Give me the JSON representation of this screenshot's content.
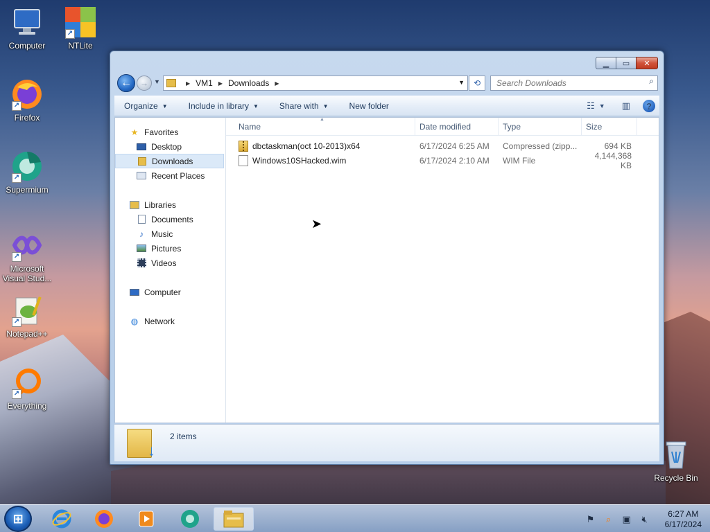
{
  "desktop": {
    "icons": [
      {
        "label": "Computer",
        "glyph": "monitor-icon"
      },
      {
        "label": "NTLite",
        "glyph": "ntlite-icon"
      },
      {
        "label": "Firefox",
        "glyph": "firefox-icon"
      },
      {
        "label": "Supermium",
        "glyph": "supermium-icon"
      },
      {
        "label": "Microsoft Visual Stud...",
        "glyph": "visual-studio-icon"
      },
      {
        "label": "Notepad++",
        "glyph": "notepadpp-icon"
      },
      {
        "label": "Everything",
        "glyph": "everything-icon"
      },
      {
        "label": "Recycle Bin",
        "glyph": "recycle-bin-icon"
      }
    ]
  },
  "explorer": {
    "breadcrumb": [
      "VM1",
      "Downloads"
    ],
    "search_placeholder": "Search Downloads",
    "toolbar": {
      "organize": "Organize",
      "include_in_library": "Include in library",
      "share_with": "Share with",
      "new_folder": "New folder"
    },
    "nav": {
      "favorites": "Favorites",
      "desktop": "Desktop",
      "downloads": "Downloads",
      "recent_places": "Recent Places",
      "libraries": "Libraries",
      "documents": "Documents",
      "music": "Music",
      "pictures": "Pictures",
      "videos": "Videos",
      "computer": "Computer",
      "network": "Network"
    },
    "columns": {
      "name": "Name",
      "date_modified": "Date modified",
      "type": "Type",
      "size": "Size"
    },
    "files": [
      {
        "name": "dbctaskman(oct 10-2013)x64",
        "date": "6/17/2024 6:25 AM",
        "type": "Compressed (zipp...",
        "size": "694 KB"
      },
      {
        "name": "Windows10SHacked.wim",
        "date": "6/17/2024 2:10 AM",
        "type": "WIM File",
        "size": "4,144,368 KB"
      }
    ],
    "status": "2 items"
  },
  "taskbar": {
    "clock_time": "6:27 AM",
    "clock_date": "6/17/2024"
  }
}
